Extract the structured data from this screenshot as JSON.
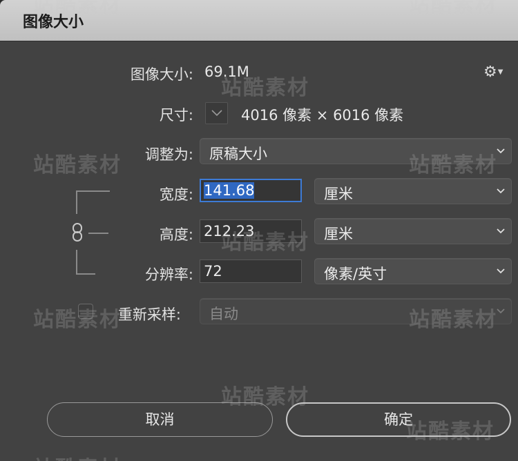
{
  "dialog": {
    "title": "图像大小"
  },
  "info": {
    "image_size_label": "图像大小:",
    "image_size_value": "69.1M",
    "dimensions_label": "尺寸:",
    "dimensions_value": "4016 像素 × 6016 像素"
  },
  "fit_to": {
    "label": "调整为:",
    "value": "原稿大小"
  },
  "width": {
    "label": "宽度:",
    "value": "141.68",
    "unit": "厘米"
  },
  "height": {
    "label": "高度:",
    "value": "212.23",
    "unit": "厘米"
  },
  "resolution": {
    "label": "分辨率:",
    "value": "72",
    "unit": "像素/英寸"
  },
  "resample": {
    "label": "重新采样:",
    "checked": false,
    "value": "自动"
  },
  "buttons": {
    "cancel": "取消",
    "ok": "确定"
  },
  "watermark": {
    "text": "站酷素材"
  },
  "icons": {
    "settings": "gear-icon",
    "constrain": "link-icon",
    "dropdown": "chevron-down-icon"
  },
  "colors": {
    "accent": "#3d7bd6",
    "selection": "#2f68c2"
  }
}
